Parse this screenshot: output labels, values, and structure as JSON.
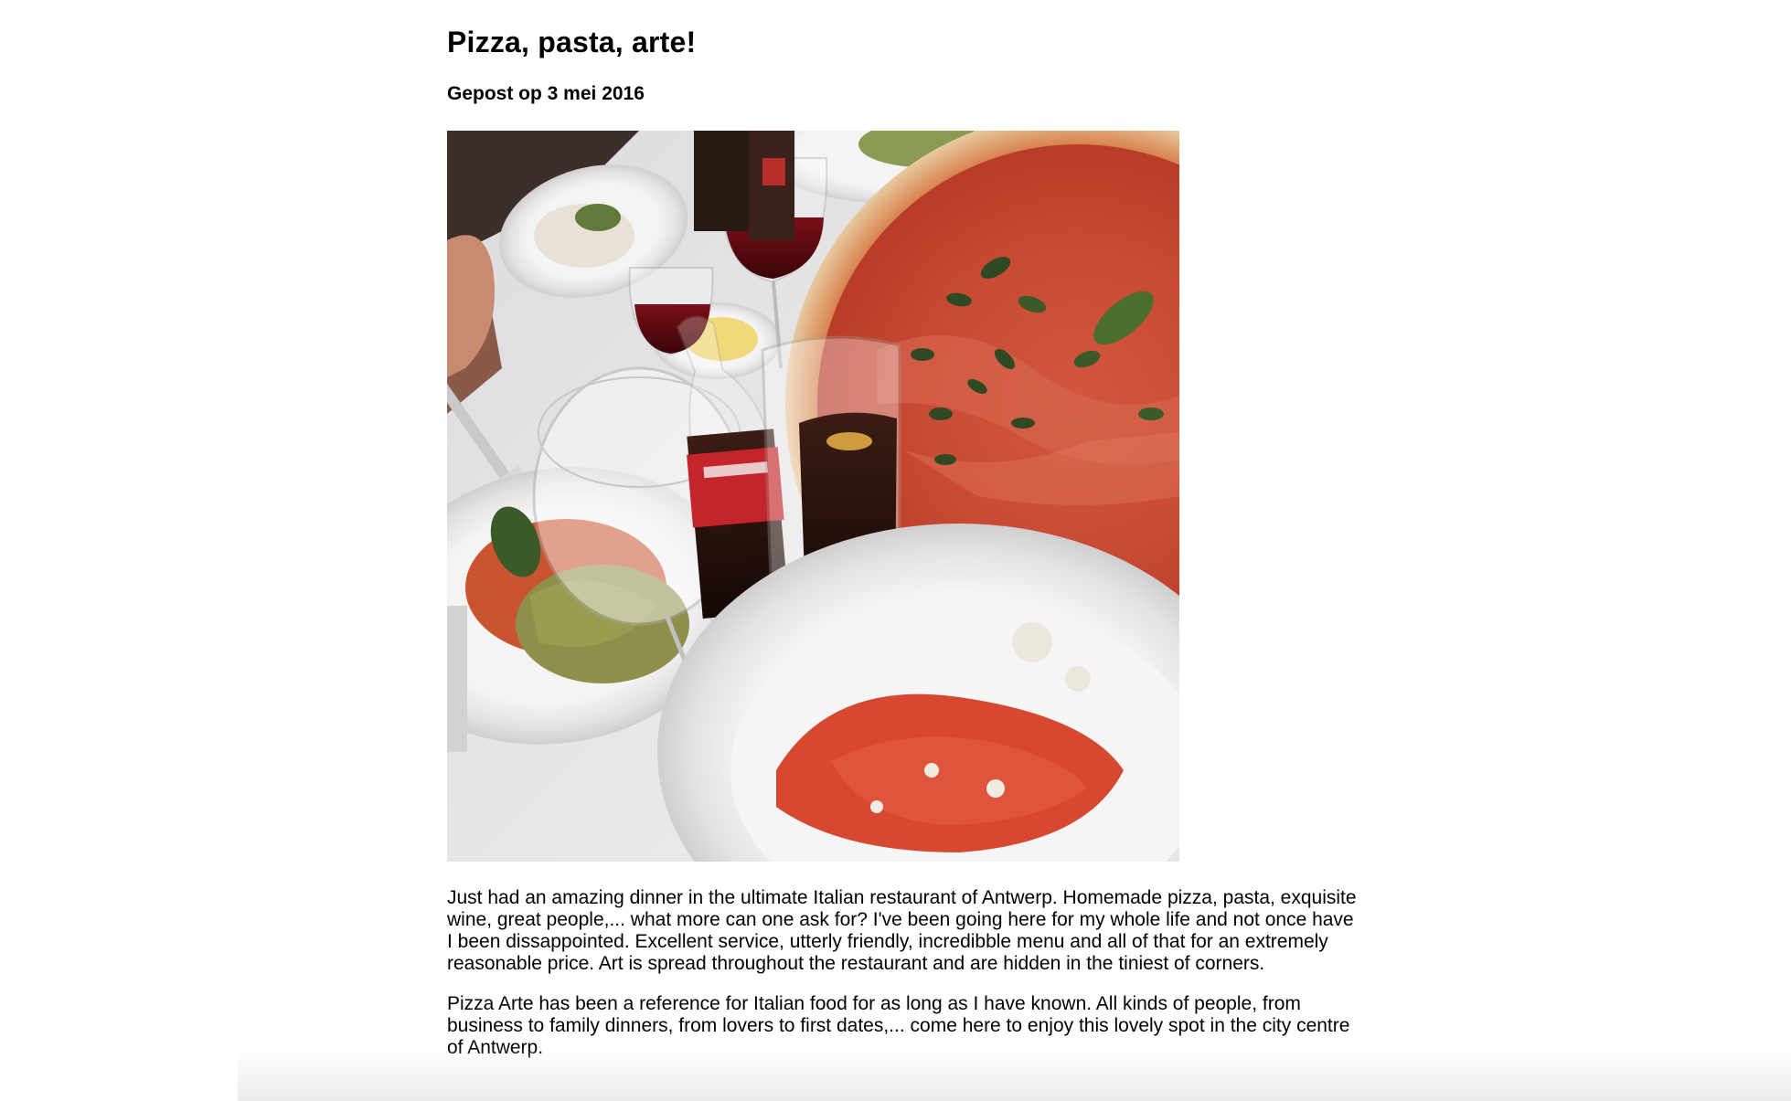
{
  "post": {
    "title": "Pizza, pasta, arte!",
    "date": "Gepost op 3 mei 2016",
    "paragraphs": [
      "Just had an amazing dinner in the ultimate Italian restaurant of Antwerp. Homemade pizza, pasta, exquisite wine, great people,... what more can one ask for? I've been going here for my whole life and not once have I been dissappointed. Excellent service, utterly friendly, incredibble menu and all of that for an extremely reasonable price. Art is spread throughout the restaurant and are hidden in the tiniest of corners.",
      "Pizza Arte has been a reference for Italian food for as long as I have known. All kinds of people, from business to family dinners, from lovers to first dates,... come here to enjoy this lovely spot in the city centre of Antwerp."
    ]
  }
}
